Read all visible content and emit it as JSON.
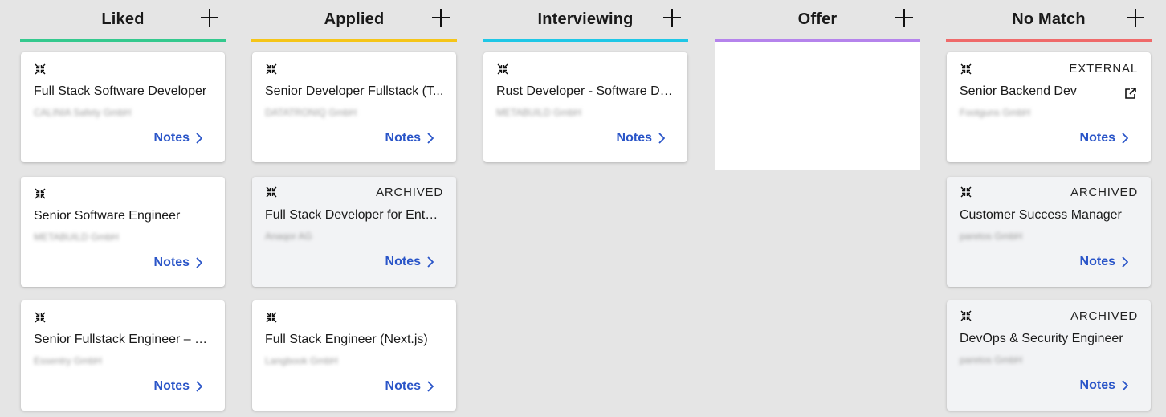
{
  "columns": [
    {
      "title": "Liked",
      "accent": "#34c98e",
      "cards": [
        {
          "title": "Full Stack Software Developer",
          "company": "CALINIA Safety GmbH",
          "notes": "Notes",
          "tag": ""
        },
        {
          "title": "Senior Software Engineer",
          "company": "METABUILD GmbH",
          "notes": "Notes",
          "tag": ""
        },
        {
          "title": "Senior Fullstack Engineer – N...",
          "company": "Essentry GmbH",
          "notes": "Notes",
          "tag": ""
        }
      ]
    },
    {
      "title": "Applied",
      "accent": "#f5c518",
      "cards": [
        {
          "title": "Senior Developer Fullstack (T...",
          "company": "DATATRONIQ GmbH",
          "notes": "Notes",
          "tag": ""
        },
        {
          "title": "Full Stack Developer for Enter...",
          "company": "Anaqor AG",
          "notes": "Notes",
          "tag": "ARCHIVED"
        },
        {
          "title": "Full Stack Engineer (Next.js)",
          "company": "Langbook GmbH",
          "notes": "Notes",
          "tag": ""
        }
      ]
    },
    {
      "title": "Interviewing",
      "accent": "#1fc7e6",
      "cards": [
        {
          "title": "Rust Developer - Software De...",
          "company": "METABUILD GmbH",
          "notes": "Notes",
          "tag": ""
        }
      ]
    },
    {
      "title": "Offer",
      "accent": "#b583ec",
      "cards": []
    },
    {
      "title": "No Match",
      "accent": "#ef6a6a",
      "cards": [
        {
          "title": "Senior Backend Dev",
          "company": "Footguns GmbH",
          "notes": "Notes",
          "tag": "EXTERNAL",
          "external": true
        },
        {
          "title": "Customer Success Manager",
          "company": "paretos GmbH",
          "notes": "Notes",
          "tag": "ARCHIVED"
        },
        {
          "title": "DevOps & Security Engineer",
          "company": "paretos GmbH",
          "notes": "Notes",
          "tag": "ARCHIVED"
        }
      ]
    }
  ],
  "icons": {
    "collapse": "collapse-arrows-icon",
    "add": "plus-icon",
    "chevron": "chevron-right-icon",
    "external": "external-link-icon"
  }
}
